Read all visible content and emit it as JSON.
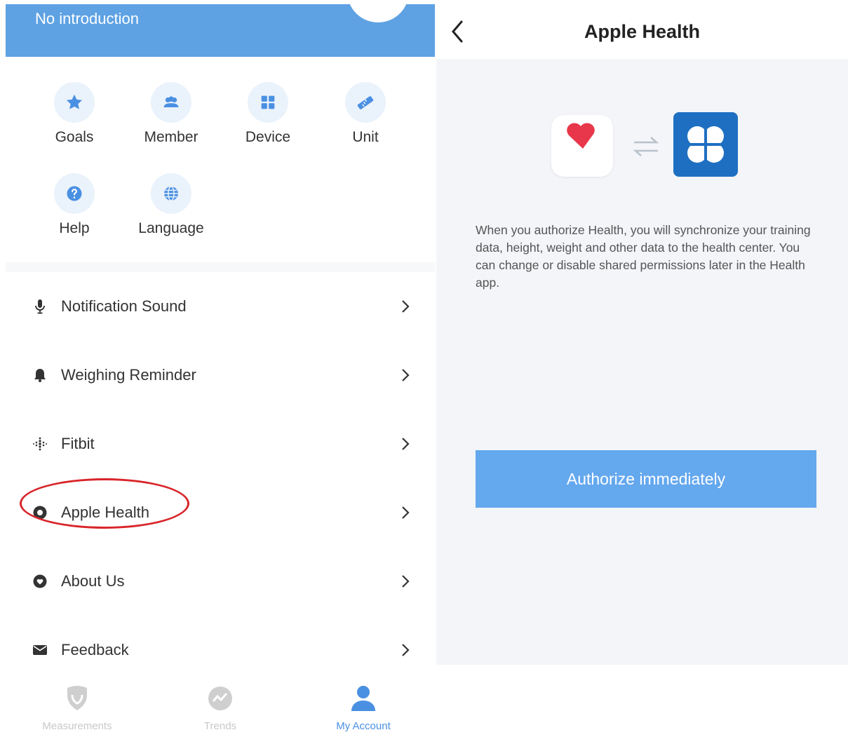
{
  "profile": {
    "introduction": "No introduction"
  },
  "quick_actions": [
    {
      "label": "Goals",
      "icon": "star-icon"
    },
    {
      "label": "Member",
      "icon": "people-icon"
    },
    {
      "label": "Device",
      "icon": "grid-icon"
    },
    {
      "label": "Unit",
      "icon": "ruler-icon"
    },
    {
      "label": "Help",
      "icon": "question-icon"
    },
    {
      "label": "Language",
      "icon": "globe-icon"
    }
  ],
  "menu": [
    {
      "label": "Notification Sound",
      "icon": "microphone-icon"
    },
    {
      "label": "Weighing Reminder",
      "icon": "bell-icon"
    },
    {
      "label": "Fitbit",
      "icon": "fitbit-icon"
    },
    {
      "label": "Apple Health",
      "icon": "apple-health-icon",
      "highlighted": true
    },
    {
      "label": "About Us",
      "icon": "heart-badge-icon"
    },
    {
      "label": "Feedback",
      "icon": "envelope-icon"
    }
  ],
  "tabbar": [
    {
      "label": "Measurements",
      "icon": "shield-icon",
      "active": false
    },
    {
      "label": "Trends",
      "icon": "chart-circle-icon",
      "active": false
    },
    {
      "label": "My Account",
      "icon": "person-icon",
      "active": true
    }
  ],
  "apple_health_page": {
    "title": "Apple Health",
    "description": "When you authorize Health, you will synchronize your training data, height, weight and other data to the health center. You can change or disable shared permissions later in the Health app.",
    "authorize_button": "Authorize immediately"
  },
  "colors": {
    "header_blue": "#5ea2e3",
    "accent_blue": "#4a90e2",
    "button_blue": "#64a8ee",
    "highlight_red": "#d8252a",
    "heart_red": "#e8374a"
  }
}
